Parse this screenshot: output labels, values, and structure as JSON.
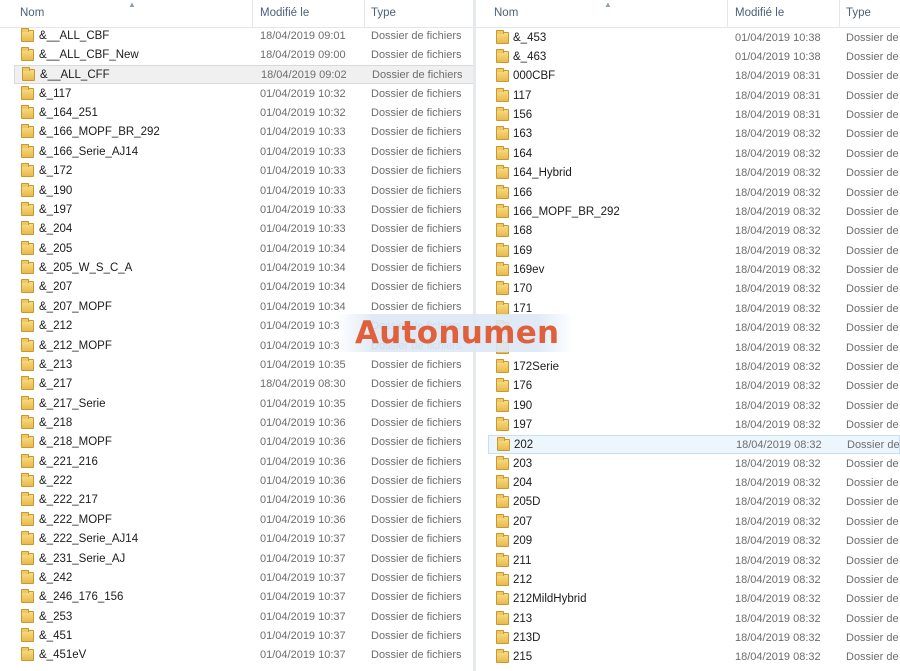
{
  "left_pane": {
    "columns": {
      "name": "Nom",
      "modified": "Modifié le",
      "type": "Type"
    },
    "rows": [
      {
        "name": "&__ALL_CBF",
        "date": "18/04/2019 09:01",
        "type": "Dossier de fichiers"
      },
      {
        "name": "&__ALL_CBF_New",
        "date": "18/04/2019 09:00",
        "type": "Dossier de fichiers"
      },
      {
        "name": "&__ALL_CFF",
        "date": "18/04/2019 09:02",
        "type": "Dossier de fichiers"
      },
      {
        "name": "&_117",
        "date": "01/04/2019 10:32",
        "type": "Dossier de fichiers"
      },
      {
        "name": "&_164_251",
        "date": "01/04/2019 10:32",
        "type": "Dossier de fichiers"
      },
      {
        "name": "&_166_MOPF_BR_292",
        "date": "01/04/2019 10:33",
        "type": "Dossier de fichiers"
      },
      {
        "name": "&_166_Serie_AJ14",
        "date": "01/04/2019 10:33",
        "type": "Dossier de fichiers"
      },
      {
        "name": "&_172",
        "date": "01/04/2019 10:33",
        "type": "Dossier de fichiers"
      },
      {
        "name": "&_190",
        "date": "01/04/2019 10:33",
        "type": "Dossier de fichiers"
      },
      {
        "name": "&_197",
        "date": "01/04/2019 10:33",
        "type": "Dossier de fichiers"
      },
      {
        "name": "&_204",
        "date": "01/04/2019 10:33",
        "type": "Dossier de fichiers"
      },
      {
        "name": "&_205",
        "date": "01/04/2019 10:34",
        "type": "Dossier de fichiers"
      },
      {
        "name": "&_205_W_S_C_A",
        "date": "01/04/2019 10:34",
        "type": "Dossier de fichiers"
      },
      {
        "name": "&_207",
        "date": "01/04/2019 10:34",
        "type": "Dossier de fichiers"
      },
      {
        "name": "&_207_MOPF",
        "date": "01/04/2019 10:34",
        "type": "Dossier de fichiers"
      },
      {
        "name": "&_212",
        "date": "01/04/2019 10:3",
        "type": "Dossier de fichiers"
      },
      {
        "name": "&_212_MOPF",
        "date": "01/04/2019 10:3",
        "type": "Dossier de fichiers"
      },
      {
        "name": "&_213",
        "date": "01/04/2019 10:35",
        "type": "Dossier de fichiers"
      },
      {
        "name": "&_217",
        "date": "18/04/2019 08:30",
        "type": "Dossier de fichiers"
      },
      {
        "name": "&_217_Serie",
        "date": "01/04/2019 10:35",
        "type": "Dossier de fichiers"
      },
      {
        "name": "&_218",
        "date": "01/04/2019 10:36",
        "type": "Dossier de fichiers"
      },
      {
        "name": "&_218_MOPF",
        "date": "01/04/2019 10:36",
        "type": "Dossier de fichiers"
      },
      {
        "name": "&_221_216",
        "date": "01/04/2019 10:36",
        "type": "Dossier de fichiers"
      },
      {
        "name": "&_222",
        "date": "01/04/2019 10:36",
        "type": "Dossier de fichiers"
      },
      {
        "name": "&_222_217",
        "date": "01/04/2019 10:36",
        "type": "Dossier de fichiers"
      },
      {
        "name": "&_222_MOPF",
        "date": "01/04/2019 10:36",
        "type": "Dossier de fichiers"
      },
      {
        "name": "&_222_Serie_AJ14",
        "date": "01/04/2019 10:37",
        "type": "Dossier de fichiers"
      },
      {
        "name": "&_231_Serie_AJ",
        "date": "01/04/2019 10:37",
        "type": "Dossier de fichiers"
      },
      {
        "name": "&_242",
        "date": "01/04/2019 10:37",
        "type": "Dossier de fichiers"
      },
      {
        "name": "&_246_176_156",
        "date": "01/04/2019 10:37",
        "type": "Dossier de fichiers"
      },
      {
        "name": "&_253",
        "date": "01/04/2019 10:37",
        "type": "Dossier de fichiers"
      },
      {
        "name": "&_451",
        "date": "01/04/2019 10:37",
        "type": "Dossier de fichiers"
      },
      {
        "name": "&_451eV",
        "date": "01/04/2019 10:37",
        "type": "Dossier de fichiers"
      }
    ]
  },
  "right_pane": {
    "columns": {
      "name": "Nom",
      "modified": "Modifié le",
      "type": "Type"
    },
    "rows": [
      {
        "name": "&_453",
        "date": "01/04/2019 10:38",
        "type": "Dossier de"
      },
      {
        "name": "&_463",
        "date": "01/04/2019 10:38",
        "type": "Dossier de"
      },
      {
        "name": "000CBF",
        "date": "18/04/2019 08:31",
        "type": "Dossier de"
      },
      {
        "name": "117",
        "date": "18/04/2019 08:31",
        "type": "Dossier de"
      },
      {
        "name": "156",
        "date": "18/04/2019 08:31",
        "type": "Dossier de"
      },
      {
        "name": "163",
        "date": "18/04/2019 08:32",
        "type": "Dossier de"
      },
      {
        "name": "164",
        "date": "18/04/2019 08:32",
        "type": "Dossier de"
      },
      {
        "name": "164_Hybrid",
        "date": "18/04/2019 08:32",
        "type": "Dossier de"
      },
      {
        "name": "166",
        "date": "18/04/2019 08:32",
        "type": "Dossier de"
      },
      {
        "name": "166_MOPF_BR_292",
        "date": "18/04/2019 08:32",
        "type": "Dossier de"
      },
      {
        "name": "168",
        "date": "18/04/2019 08:32",
        "type": "Dossier de"
      },
      {
        "name": "169",
        "date": "18/04/2019 08:32",
        "type": "Dossier de"
      },
      {
        "name": "169ev",
        "date": "18/04/2019 08:32",
        "type": "Dossier de"
      },
      {
        "name": "170",
        "date": "18/04/2019 08:32",
        "type": "Dossier de"
      },
      {
        "name": "171",
        "date": "18/04/2019 08:32",
        "type": "Dossier de"
      },
      {
        "name": "",
        "date": "18/04/2019 08:32",
        "type": "Dossier de"
      },
      {
        "name": "",
        "date": "18/04/2019 08:32",
        "type": "Dossier de"
      },
      {
        "name": "172Serie",
        "date": "18/04/2019 08:32",
        "type": "Dossier de"
      },
      {
        "name": "176",
        "date": "18/04/2019 08:32",
        "type": "Dossier de"
      },
      {
        "name": "190",
        "date": "18/04/2019 08:32",
        "type": "Dossier de"
      },
      {
        "name": "197",
        "date": "18/04/2019 08:32",
        "type": "Dossier de"
      },
      {
        "name": "202",
        "date": "18/04/2019 08:32",
        "type": "Dossier de"
      },
      {
        "name": "203",
        "date": "18/04/2019 08:32",
        "type": "Dossier de"
      },
      {
        "name": "204",
        "date": "18/04/2019 08:32",
        "type": "Dossier de"
      },
      {
        "name": "205D",
        "date": "18/04/2019 08:32",
        "type": "Dossier de"
      },
      {
        "name": "207",
        "date": "18/04/2019 08:32",
        "type": "Dossier de"
      },
      {
        "name": "209",
        "date": "18/04/2019 08:32",
        "type": "Dossier de"
      },
      {
        "name": "211",
        "date": "18/04/2019 08:32",
        "type": "Dossier de"
      },
      {
        "name": "212",
        "date": "18/04/2019 08:32",
        "type": "Dossier de"
      },
      {
        "name": "212MildHybrid",
        "date": "18/04/2019 08:32",
        "type": "Dossier de"
      },
      {
        "name": "213",
        "date": "18/04/2019 08:32",
        "type": "Dossier de"
      },
      {
        "name": "213D",
        "date": "18/04/2019 08:32",
        "type": "Dossier de"
      },
      {
        "name": "215",
        "date": "18/04/2019 08:32",
        "type": "Dossier de"
      }
    ]
  },
  "watermark": {
    "text": "Autonumen",
    "color": "#e0603b"
  }
}
